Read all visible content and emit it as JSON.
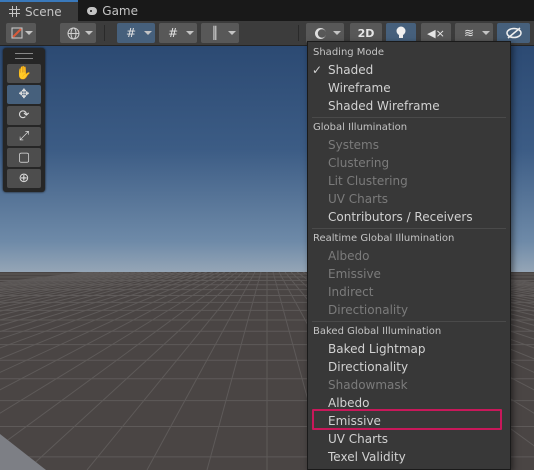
{
  "tabs": [
    {
      "label": "Scene",
      "icon": "grid-icon",
      "active": true
    },
    {
      "label": "Game",
      "icon": "gamepad-icon",
      "active": false
    }
  ],
  "toolbar": {
    "mode_2d_label": "2D"
  },
  "tools": [
    "hand-tool",
    "move-tool",
    "rotate-tool",
    "scale-tool",
    "rect-tool",
    "transform-tool"
  ],
  "menu": {
    "sections": [
      {
        "header": "Shading Mode",
        "items": [
          {
            "label": "Shaded",
            "checked": true,
            "disabled": false
          },
          {
            "label": "Wireframe",
            "disabled": false
          },
          {
            "label": "Shaded Wireframe",
            "disabled": false
          }
        ]
      },
      {
        "header": "Global Illumination",
        "items": [
          {
            "label": "Systems",
            "disabled": true
          },
          {
            "label": "Clustering",
            "disabled": true
          },
          {
            "label": "Lit Clustering",
            "disabled": true
          },
          {
            "label": "UV Charts",
            "disabled": true
          },
          {
            "label": "Contributors / Receivers",
            "disabled": false
          }
        ]
      },
      {
        "header": "Realtime Global Illumination",
        "items": [
          {
            "label": "Albedo",
            "disabled": true
          },
          {
            "label": "Emissive",
            "disabled": true
          },
          {
            "label": "Indirect",
            "disabled": true
          },
          {
            "label": "Directionality",
            "disabled": true
          }
        ]
      },
      {
        "header": "Baked Global Illumination",
        "items": [
          {
            "label": "Baked Lightmap",
            "disabled": false
          },
          {
            "label": "Directionality",
            "disabled": false
          },
          {
            "label": "Shadowmask",
            "disabled": true
          },
          {
            "label": "Albedo",
            "disabled": false
          },
          {
            "label": "Emissive",
            "disabled": false,
            "highlighted": true
          },
          {
            "label": "UV Charts",
            "disabled": false
          },
          {
            "label": "Texel Validity",
            "disabled": false
          }
        ]
      }
    ]
  },
  "colors": {
    "highlight_border": "#c8185a",
    "active_accent": "#46607c",
    "tab_accent": "#3a79bb"
  }
}
